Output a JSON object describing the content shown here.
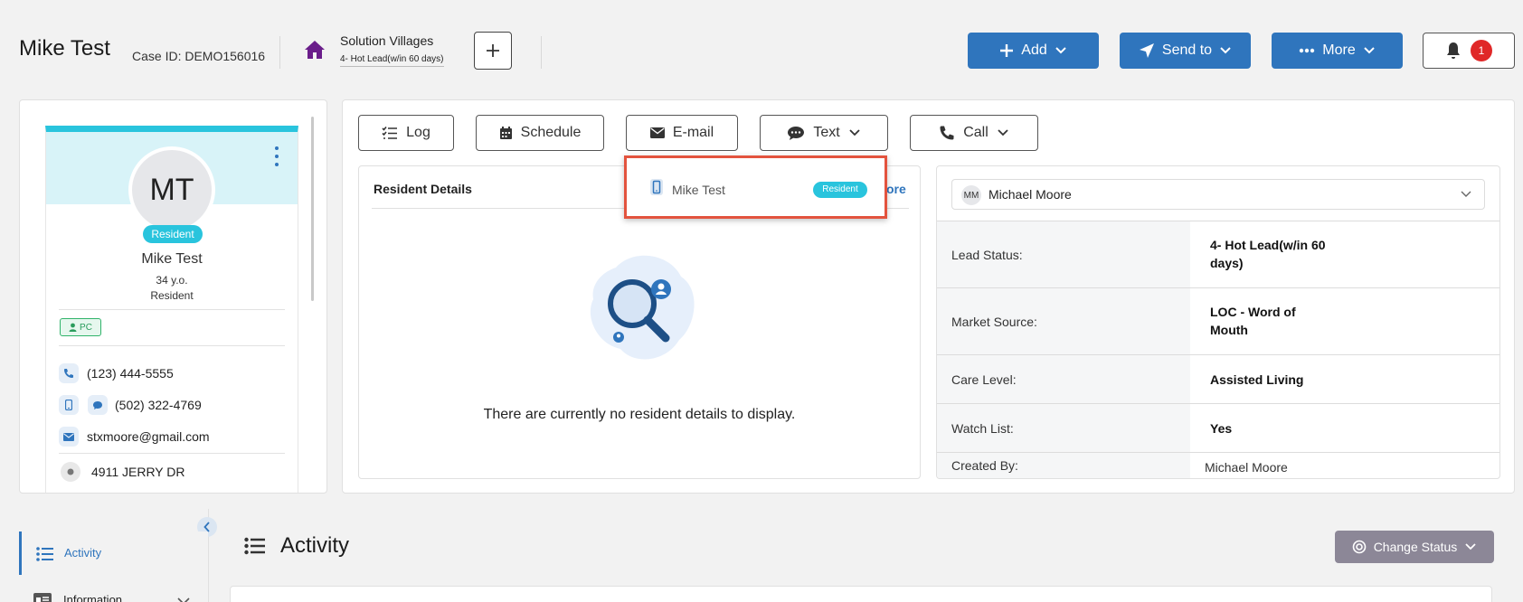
{
  "header": {
    "title": "Mike Test",
    "case_id": "Case ID: DEMO156016",
    "community_name": "Solution Villages",
    "community_status": "4- Hot Lead(w/in 60 days)",
    "add_label": "Add",
    "send_label": "Send to",
    "more_label": "More",
    "notification_count": "1"
  },
  "profile": {
    "initials": "MT",
    "role_badge": "Resident",
    "name": "Mike Test",
    "age": "34 y.o.",
    "role": "Resident",
    "tag": "PC",
    "phone": "(123) 444-5555",
    "mobile": "(502) 322-4769",
    "email": "stxmoore@gmail.com",
    "address": "4911 JERRY DR"
  },
  "actions": {
    "log": "Log",
    "schedule": "Schedule",
    "email": "E-mail",
    "text": "Text",
    "call": "Call"
  },
  "resident_details": {
    "title": "Resident Details",
    "more_link": "ore",
    "empty_message": "There are currently no resident details to display."
  },
  "text_dropdown": {
    "contact_name": "Mike Test",
    "contact_badge": "Resident"
  },
  "info": {
    "selected_user_initials": "MM",
    "selected_user": "Michael Moore",
    "rows": [
      {
        "label": "Lead Status:",
        "value": "4- Hot Lead(w/in 60 days)"
      },
      {
        "label": "Market Source:",
        "value": "LOC - Word of Mouth"
      },
      {
        "label": "Care Level:",
        "value": "Assisted Living"
      },
      {
        "label": "Watch List:",
        "value": "Yes"
      },
      {
        "label": "Created By:",
        "value": "Michael Moore"
      }
    ]
  },
  "lower": {
    "nav_activity": "Activity",
    "nav_information": "Information",
    "section_title": "Activity",
    "change_status": "Change Status"
  },
  "colors": {
    "primary": "#2f75bd",
    "resident_badge": "#29c4dd",
    "highlight_border": "#e3533e",
    "notification": "#e02828"
  }
}
